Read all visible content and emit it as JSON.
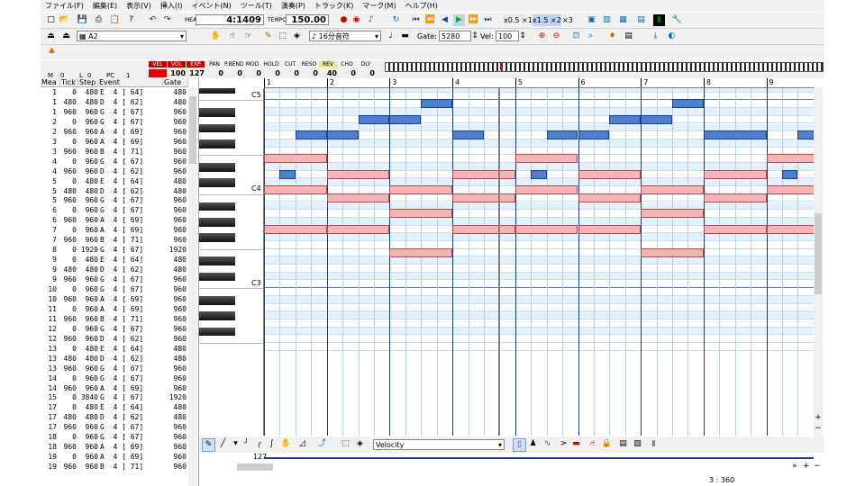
{
  "menu": [
    "ファイル(F)",
    "編集(E)",
    "表示(V)",
    "挿入(I)",
    "イベント(N)",
    "ツール(T)",
    "演奏(P)",
    "トラック(K)",
    "マーク(M)",
    "ヘルプ(H)"
  ],
  "transport": {
    "meas_label": "MEAS",
    "position": "4:1409",
    "tempo_label": "TEMPO",
    "tempo": "150.00",
    "speed_half": "x0.5 ×1",
    "speed_15": "x1.5 ×2",
    "speed_3": "×3"
  },
  "toolbar2": {
    "track_name": "A2",
    "note_length": "16分音符",
    "gate_label": "Gate:",
    "gate_value": "5280",
    "vel_label": "Vel:",
    "vel_value": "100"
  },
  "mixer": {
    "m_label": "M",
    "m_value": "0",
    "l_label": "L",
    "l_value": "0",
    "pc_label": "PC",
    "pc_value": "1",
    "channels": [
      {
        "name": "VEL",
        "value": ""
      },
      {
        "name": "VOL",
        "value": "100"
      },
      {
        "name": "EXP",
        "value": "127"
      },
      {
        "name": "PAN",
        "value": "0"
      },
      {
        "name": "P.BEND",
        "value": "0"
      },
      {
        "name": "MOD",
        "value": "0"
      },
      {
        "name": "HOLD",
        "value": "0"
      },
      {
        "name": "CUT",
        "value": "0"
      },
      {
        "name": "RESO",
        "value": "0"
      },
      {
        "name": "REV",
        "value": "40"
      },
      {
        "name": "CHO",
        "value": "0"
      },
      {
        "name": "DLY",
        "value": "0"
      }
    ]
  },
  "event_list": {
    "headers": [
      "Mea",
      "Tick",
      "Step",
      "Event",
      "Gate"
    ],
    "rows": [
      [
        "1",
        "0",
        "480",
        "E  4 [ 64]",
        "480"
      ],
      [
        "1",
        "480",
        "480",
        "D  4 [ 62]",
        "480"
      ],
      [
        "1",
        "960",
        "960",
        "G  4 [ 67]",
        "960"
      ],
      [
        "2",
        "0",
        "960",
        "G  4 [ 67]",
        "960"
      ],
      [
        "2",
        "960",
        "960",
        "A  4 [ 69]",
        "960"
      ],
      [
        "3",
        "0",
        "960",
        "A  4 [ 69]",
        "960"
      ],
      [
        "3",
        "960",
        "960",
        "B  4 [ 71]",
        "960"
      ],
      [
        "4",
        "0",
        "960",
        "G  4 [ 67]",
        "960"
      ],
      [
        "4",
        "960",
        "960",
        "D  4 [ 62]",
        "960"
      ],
      [
        "5",
        "0",
        "480",
        "E  4 [ 64]",
        "480"
      ],
      [
        "5",
        "480",
        "480",
        "D  4 [ 62]",
        "480"
      ],
      [
        "5",
        "960",
        "960",
        "G  4 [ 67]",
        "960"
      ],
      [
        "6",
        "0",
        "960",
        "G  4 [ 67]",
        "960"
      ],
      [
        "6",
        "960",
        "960",
        "A  4 [ 69]",
        "960"
      ],
      [
        "7",
        "0",
        "960",
        "A  4 [ 69]",
        "960"
      ],
      [
        "7",
        "960",
        "960",
        "B  4 [ 71]",
        "960"
      ],
      [
        "8",
        "0",
        "1920",
        "G  4 [ 67]",
        "1920"
      ],
      [
        "9",
        "0",
        "480",
        "E  4 [ 64]",
        "480"
      ],
      [
        "9",
        "480",
        "480",
        "D  4 [ 62]",
        "480"
      ],
      [
        "9",
        "960",
        "960",
        "G  4 [ 67]",
        "960"
      ],
      [
        "10",
        "0",
        "960",
        "G  4 [ 67]",
        "960"
      ],
      [
        "10",
        "960",
        "960",
        "A  4 [ 69]",
        "960"
      ],
      [
        "11",
        "0",
        "960",
        "A  4 [ 69]",
        "960"
      ],
      [
        "11",
        "960",
        "960",
        "B  4 [ 71]",
        "960"
      ],
      [
        "12",
        "0",
        "960",
        "G  4 [ 67]",
        "960"
      ],
      [
        "12",
        "960",
        "960",
        "D  4 [ 62]",
        "960"
      ],
      [
        "13",
        "0",
        "480",
        "E  4 [ 64]",
        "480"
      ],
      [
        "13",
        "480",
        "480",
        "D  4 [ 62]",
        "480"
      ],
      [
        "13",
        "960",
        "960",
        "G  4 [ 67]",
        "960"
      ],
      [
        "14",
        "0",
        "960",
        "G  4 [ 67]",
        "960"
      ],
      [
        "14",
        "960",
        "960",
        "A  4 [ 69]",
        "960"
      ],
      [
        "15",
        "0",
        "3840",
        "G  4 [ 67]",
        "1920"
      ],
      [
        "17",
        "0",
        "480",
        "E  4 [ 64]",
        "480"
      ],
      [
        "17",
        "480",
        "480",
        "D  4 [ 62]",
        "480"
      ],
      [
        "17",
        "960",
        "960",
        "G  4 [ 67]",
        "960"
      ],
      [
        "18",
        "0",
        "960",
        "G  4 [ 67]",
        "960"
      ],
      [
        "18",
        "960",
        "960",
        "A  4 [ 69]",
        "960"
      ],
      [
        "19",
        "0",
        "960",
        "A  4 [ 69]",
        "960"
      ],
      [
        "19",
        "960",
        "960",
        "B  4 [ 71]",
        "960"
      ]
    ]
  },
  "piano_roll": {
    "measures": [
      "1",
      "2",
      "3",
      "4",
      "5",
      "6",
      "7",
      "8",
      "9"
    ],
    "octave_labels": [
      "C5",
      "C4",
      "C3"
    ],
    "playhead_measure": "4:1409"
  },
  "bottom": {
    "controller": "Velocity",
    "max_value": "127",
    "status": "3 : 360"
  },
  "colors": {
    "upper_note": "#4a7fd4",
    "lower_note": "#f7b4b4",
    "measure_line": "#1c3e8c"
  }
}
